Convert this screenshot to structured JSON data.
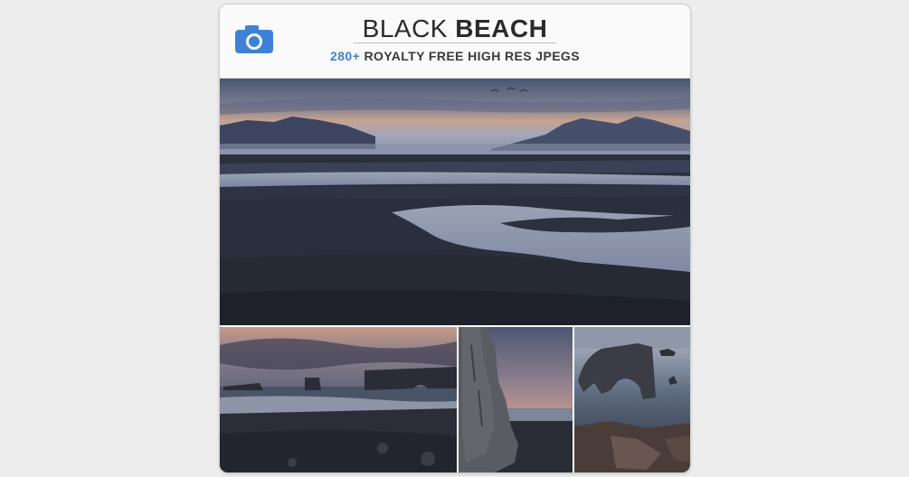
{
  "header": {
    "icon": "camera-icon",
    "title_light": "BLACK",
    "title_bold": "BEACH",
    "count": "280+",
    "subtitle_rest": "ROYALTY FREE HIGH RES JPEGS"
  },
  "colors": {
    "accent": "#3d82d6",
    "title": "#2b2b2b",
    "background": "#ededed"
  }
}
